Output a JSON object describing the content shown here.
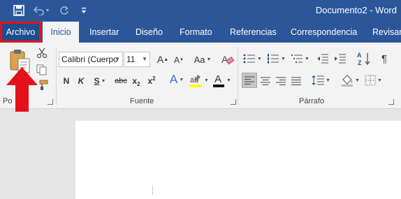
{
  "window": {
    "title": "Documento2 - Word"
  },
  "qat": {
    "save": "save-icon",
    "undo": "undo-icon",
    "undo_dropdown": "chevron-down-icon",
    "redo": "redo-icon",
    "customize": "customize-qat-icon"
  },
  "tabs": [
    {
      "label": "Archivo"
    },
    {
      "label": "Inicio"
    },
    {
      "label": "Insertar"
    },
    {
      "label": "Diseño"
    },
    {
      "label": "Formato"
    },
    {
      "label": "Referencias"
    },
    {
      "label": "Correspondencia"
    },
    {
      "label": "Revisar"
    }
  ],
  "ribbon": {
    "clipboard": {
      "label": "Portapapeles",
      "visible_label": "Po"
    },
    "font": {
      "label": "Fuente",
      "font_name": "Calibri (Cuerpo",
      "font_size": "11",
      "grow": "A",
      "shrink": "A",
      "change_case": "Aa",
      "bold": "N",
      "italic": "K",
      "underline": "S",
      "strike": "abc",
      "subscript": "x",
      "subscript_mark": "2",
      "superscript": "x",
      "superscript_mark": "2",
      "effects": "A",
      "font_color": "A"
    },
    "paragraph": {
      "label": "Párrafo",
      "sort": "A",
      "pilcrow": "¶"
    }
  },
  "colors": {
    "word_blue": "#2b579a",
    "ribbon_bg": "#f3f3f3",
    "annotation_red": "#e3121a",
    "highlight_yellow": "#ffff00",
    "font_color_bar": "#111111"
  }
}
